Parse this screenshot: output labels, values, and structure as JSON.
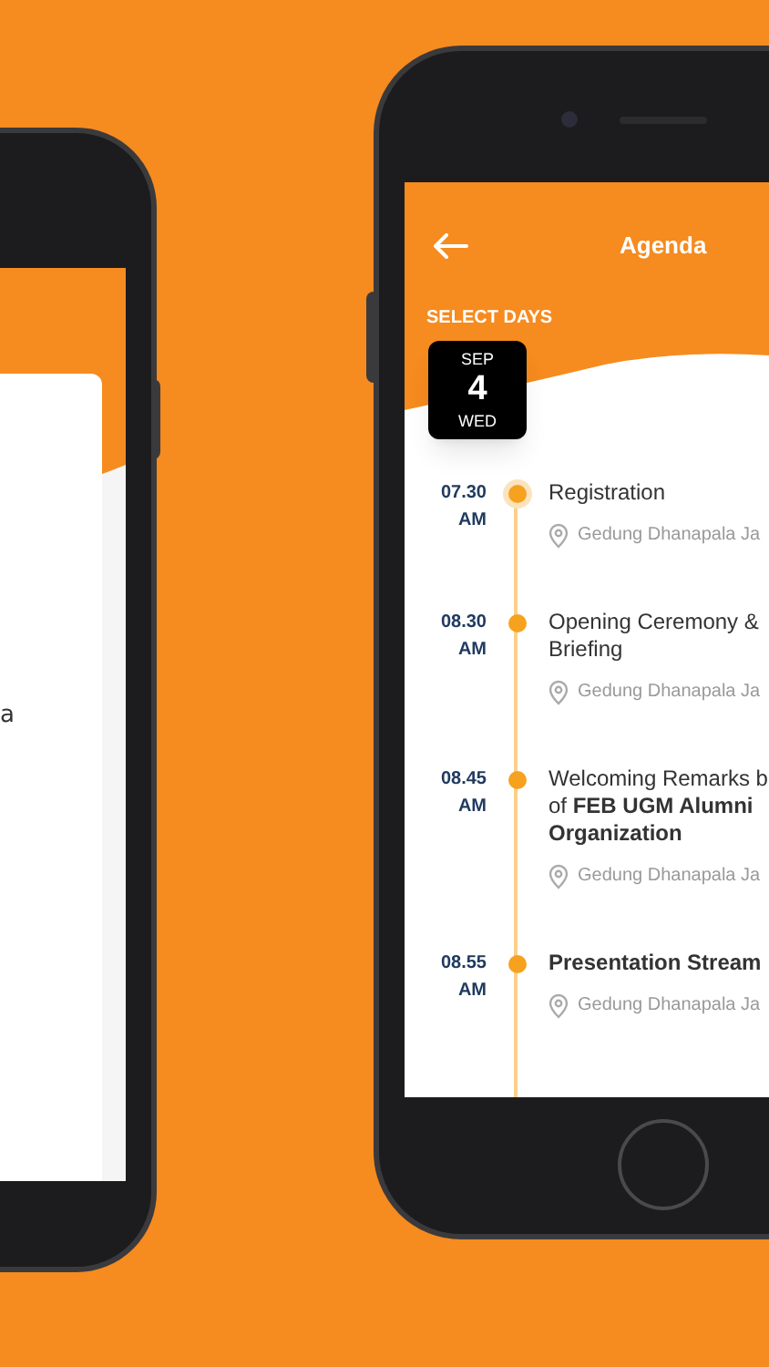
{
  "left_screen": {
    "text_fragment": "a"
  },
  "header": {
    "title": "Agenda"
  },
  "select_days_label": "SELECT DAYS",
  "days": [
    {
      "month": "SEP",
      "day": "4",
      "weekday": "WED",
      "selected": true
    }
  ],
  "events": [
    {
      "time": "07.30",
      "period": "AM",
      "title_lines": [
        "Registration"
      ],
      "bold": false,
      "current": true,
      "location": "Gedung Dhanapala Ja"
    },
    {
      "time": "08.30",
      "period": "AM",
      "title_lines": [
        "Opening Ceremony &",
        "Briefing"
      ],
      "bold": false,
      "current": false,
      "location": "Gedung Dhanapala Ja"
    },
    {
      "time": "08.45",
      "period": "AM",
      "title_lines": [
        "Welcoming Remarks b",
        "of **FEB UGM Alumni**",
        "**Organization**"
      ],
      "bold": false,
      "current": false,
      "location": "Gedung Dhanapala Ja"
    },
    {
      "time": "08.55",
      "period": "AM",
      "title_lines": [
        "Presentation Stream"
      ],
      "bold": true,
      "current": false,
      "location": "Gedung Dhanapala Ja"
    }
  ]
}
